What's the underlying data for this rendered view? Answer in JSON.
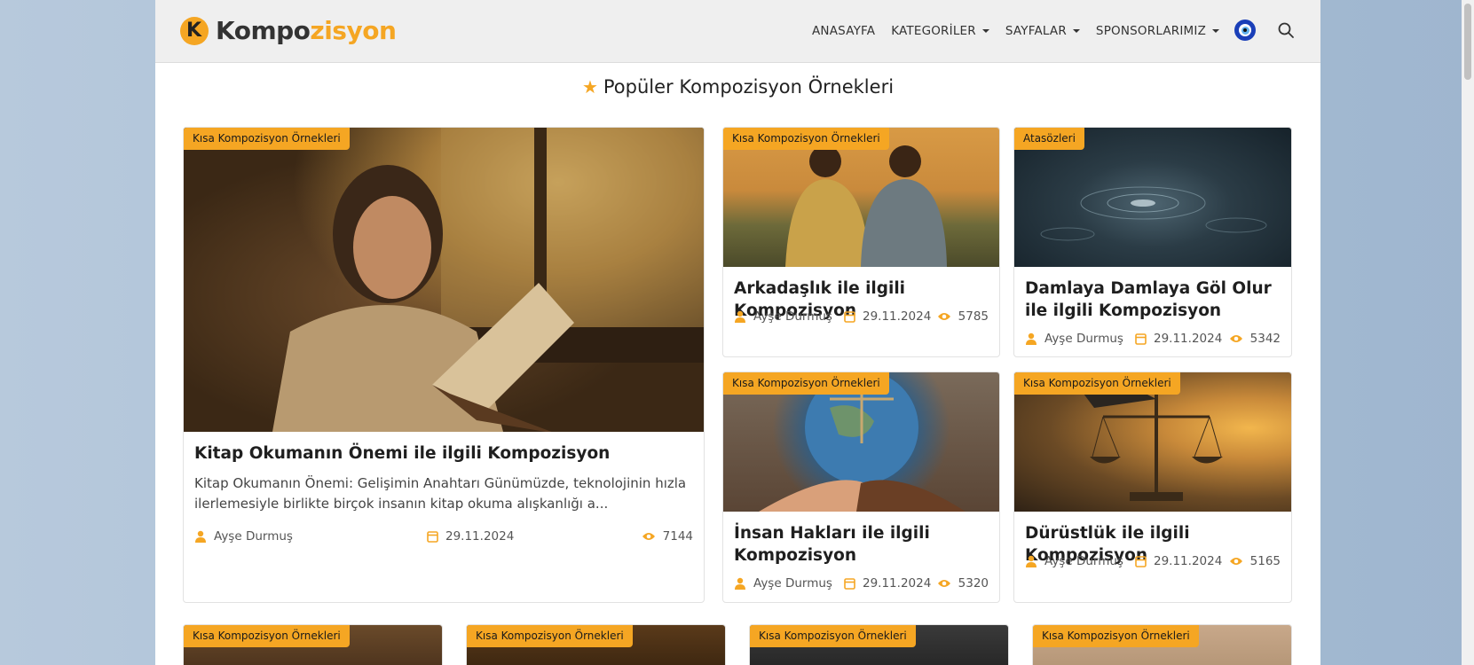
{
  "header": {
    "logo_prefix": "Kompo",
    "logo_suffix": "zisyon",
    "logo_mark": "K",
    "nav": [
      {
        "label": "ANASAYFA",
        "dropdown": false
      },
      {
        "label": "KATEGORİLER",
        "dropdown": true
      },
      {
        "label": "SAYFALAR",
        "dropdown": true
      },
      {
        "label": "SPONSORLARIMIZ",
        "dropdown": true
      }
    ],
    "icons": {
      "evil_eye": "nazar-boncugu-icon",
      "search": "search-icon"
    }
  },
  "section": {
    "title": "Popüler Kompozisyon Örnekleri",
    "icon": "star-icon"
  },
  "colors": {
    "accent": "#f5a623",
    "header_bg": "#efefef",
    "text": "#1f1f1f"
  },
  "featured": {
    "category": "Kısa Kompozisyon Örnekleri",
    "title": "Kitap Okumanın Önemi ile ilgili Kompozisyon",
    "excerpt": "Kitap Okumanın Önemi: Gelişimin Anahtarı Günümüzde, teknolojinin hızla ilerlemesiyle birlikte birçok insanın kitap okuma alışkanlığı a...",
    "author": "Ayşe Durmuş",
    "date": "29.11.2024",
    "views": "7144"
  },
  "cards": [
    {
      "category": "Kısa Kompozisyon Örnekleri",
      "title": "Arkadaşlık ile ilgili Kompozisyon",
      "author": "Ayşe Durmuş",
      "date": "29.11.2024",
      "views": "5785"
    },
    {
      "category": "Atasözleri",
      "title": "Damlaya Damlaya Göl Olur ile ilgili Kompozisyon",
      "author": "Ayşe Durmuş",
      "date": "29.11.2024",
      "views": "5342"
    },
    {
      "category": "Kısa Kompozisyon Örnekleri",
      "title": "İnsan Hakları ile ilgili Kompozisyon",
      "author": "Ayşe Durmuş",
      "date": "29.11.2024",
      "views": "5320"
    },
    {
      "category": "Kısa Kompozisyon Örnekleri",
      "title": "Dürüstlük ile ilgili Kompozisyon",
      "author": "Ayşe Durmuş",
      "date": "29.11.2024",
      "views": "5165"
    }
  ],
  "bottom_cards": [
    {
      "category": "Kısa Kompozisyon Örnekleri"
    },
    {
      "category": "Kısa Kompozisyon Örnekleri"
    },
    {
      "category": "Kısa Kompozisyon Örnekleri"
    },
    {
      "category": "Kısa Kompozisyon Örnekleri"
    }
  ]
}
